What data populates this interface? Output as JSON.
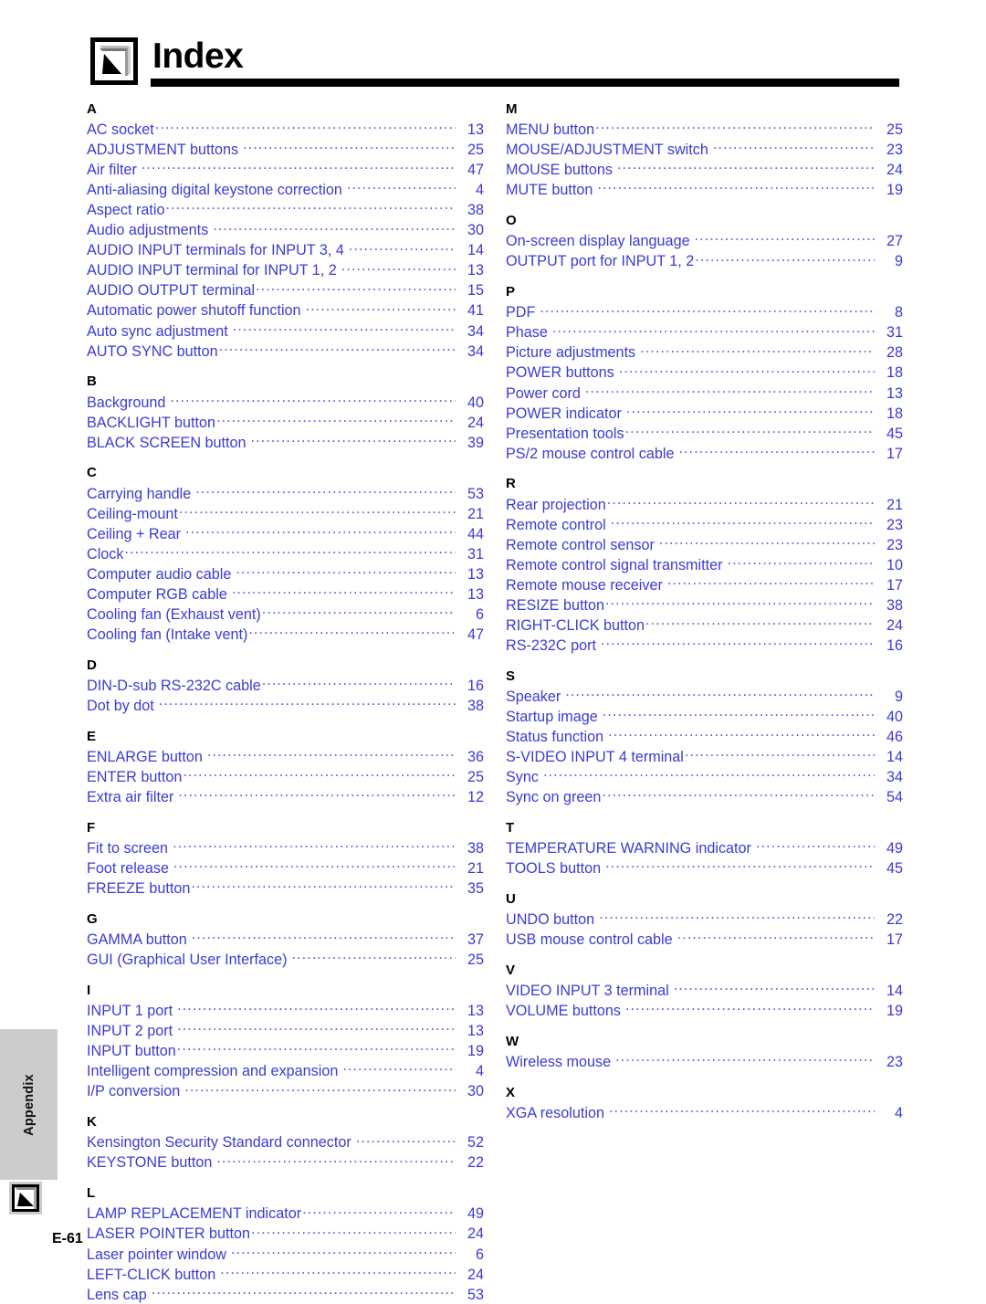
{
  "header": {
    "title": "Index",
    "icon": "book-pages-cursor-icon"
  },
  "side_tab": {
    "label": "Appendix",
    "icon": "book-page-cursor-icon"
  },
  "footer": {
    "page_label": "E-61"
  },
  "colors": {
    "entry_text": "#3b3bd4",
    "leader": "#5a5ada",
    "heading": "#000000",
    "tab_background": "#cccccc"
  },
  "columns": [
    {
      "sections": [
        {
          "letter": "A",
          "entries": [
            {
              "label": "AC socket",
              "page": "13",
              "gap": false
            },
            {
              "label": "ADJUSTMENT buttons",
              "page": "25",
              "gap": true
            },
            {
              "label": "Air filter",
              "page": "47",
              "gap": true
            },
            {
              "label": "Anti-aliasing digital keystone correction",
              "page": "4",
              "gap": true
            },
            {
              "label": "Aspect ratio",
              "page": "38",
              "gap": false
            },
            {
              "label": "Audio adjustments",
              "page": "30",
              "gap": true
            },
            {
              "label": "AUDIO INPUT terminals for INPUT 3, 4",
              "page": "14",
              "gap": true
            },
            {
              "label": "AUDIO INPUT terminal for INPUT 1, 2",
              "page": "13",
              "gap": true
            },
            {
              "label": "AUDIO OUTPUT terminal",
              "page": "15",
              "gap": false
            },
            {
              "label": "Automatic power shutoff function",
              "page": "41",
              "gap": true
            },
            {
              "label": "Auto sync adjustment",
              "page": "34",
              "gap": true
            },
            {
              "label": "AUTO SYNC button",
              "page": "34",
              "gap": false
            }
          ]
        },
        {
          "letter": "B",
          "entries": [
            {
              "label": "Background",
              "page": "40",
              "gap": true
            },
            {
              "label": "BACKLIGHT button",
              "page": "24",
              "gap": false
            },
            {
              "label": "BLACK SCREEN button",
              "page": "39",
              "gap": true
            }
          ]
        },
        {
          "letter": "C",
          "entries": [
            {
              "label": "Carrying handle",
              "page": "53",
              "gap": true
            },
            {
              "label": "Ceiling-mount",
              "page": "21",
              "gap": false
            },
            {
              "label": "Ceiling + Rear",
              "page": "44",
              "gap": true
            },
            {
              "label": "Clock",
              "page": "31",
              "gap": false
            },
            {
              "label": "Computer audio cable",
              "page": "13",
              "gap": true
            },
            {
              "label": "Computer RGB cable",
              "page": "13",
              "gap": true
            },
            {
              "label": "Cooling fan (Exhaust vent)",
              "page": "6",
              "gap": false
            },
            {
              "label": "Cooling fan (Intake vent)",
              "page": "47",
              "gap": false
            }
          ]
        },
        {
          "letter": "D",
          "entries": [
            {
              "label": "DIN-D-sub RS-232C cable",
              "page": "16",
              "gap": false
            },
            {
              "label": "Dot by dot",
              "page": "38",
              "gap": true
            }
          ]
        },
        {
          "letter": "E",
          "entries": [
            {
              "label": "ENLARGE button",
              "page": "36",
              "gap": true
            },
            {
              "label": "ENTER button",
              "page": "25",
              "gap": false
            },
            {
              "label": "Extra air filter",
              "page": "12",
              "gap": true
            }
          ]
        },
        {
          "letter": "F",
          "entries": [
            {
              "label": "Fit to screen",
              "page": "38",
              "gap": true
            },
            {
              "label": "Foot release",
              "page": "21",
              "gap": true
            },
            {
              "label": "FREEZE button",
              "page": "35",
              "gap": false
            }
          ]
        },
        {
          "letter": "G",
          "entries": [
            {
              "label": "GAMMA button",
              "page": "37",
              "gap": true
            },
            {
              "label": "GUI (Graphical User Interface)",
              "page": "25",
              "gap": true
            }
          ]
        },
        {
          "letter": "I",
          "entries": [
            {
              "label": "INPUT 1 port",
              "page": "13",
              "gap": true
            },
            {
              "label": "INPUT 2 port",
              "page": "13",
              "gap": true
            },
            {
              "label": "INPUT button",
              "page": "19",
              "gap": false
            },
            {
              "label": "Intelligent compression and expansion",
              "page": "4",
              "gap": true
            },
            {
              "label": "I/P conversion",
              "page": "30",
              "gap": true
            }
          ]
        },
        {
          "letter": "K",
          "entries": [
            {
              "label": "Kensington Security Standard connector",
              "page": "52",
              "gap": true
            },
            {
              "label": "KEYSTONE button",
              "page": "22",
              "gap": true
            }
          ]
        },
        {
          "letter": "L",
          "entries": [
            {
              "label": "LAMP REPLACEMENT indicator",
              "page": "49",
              "gap": false
            },
            {
              "label": "LASER POINTER button",
              "page": "24",
              "gap": false
            },
            {
              "label": "Laser pointer window",
              "page": "6",
              "gap": true
            },
            {
              "label": "LEFT-CLICK button",
              "page": "24",
              "gap": true
            },
            {
              "label": "Lens cap",
              "page": "53",
              "gap": true
            }
          ]
        }
      ]
    },
    {
      "sections": [
        {
          "letter": "M",
          "entries": [
            {
              "label": "MENU button",
              "page": "25",
              "gap": false
            },
            {
              "label": "MOUSE/ADJUSTMENT switch",
              "page": "23",
              "gap": true
            },
            {
              "label": "MOUSE buttons",
              "page": "24",
              "gap": true
            },
            {
              "label": "MUTE button",
              "page": "19",
              "gap": true
            }
          ]
        },
        {
          "letter": "O",
          "entries": [
            {
              "label": "On-screen display language",
              "page": "27",
              "gap": true
            },
            {
              "label": "OUTPUT port for INPUT 1, 2",
              "page": "9",
              "gap": false
            }
          ]
        },
        {
          "letter": "P",
          "entries": [
            {
              "label": "PDF",
              "page": "8",
              "gap": true
            },
            {
              "label": "Phase",
              "page": "31",
              "gap": true
            },
            {
              "label": "Picture adjustments",
              "page": "28",
              "gap": true
            },
            {
              "label": "POWER buttons",
              "page": "18",
              "gap": true
            },
            {
              "label": "Power cord",
              "page": "13",
              "gap": true
            },
            {
              "label": "POWER indicator",
              "page": "18",
              "gap": true
            },
            {
              "label": "Presentation tools",
              "page": "45",
              "gap": false
            },
            {
              "label": "PS/2 mouse control cable",
              "page": "17",
              "gap": true
            }
          ]
        },
        {
          "letter": "R",
          "entries": [
            {
              "label": "Rear projection",
              "page": "21",
              "gap": false
            },
            {
              "label": "Remote control",
              "page": "23",
              "gap": true
            },
            {
              "label": "Remote control sensor",
              "page": "23",
              "gap": true
            },
            {
              "label": "Remote control signal transmitter",
              "page": "10",
              "gap": true
            },
            {
              "label": "Remote mouse receiver",
              "page": "17",
              "gap": true
            },
            {
              "label": "RESIZE button",
              "page": "38",
              "gap": false
            },
            {
              "label": "RIGHT-CLICK button",
              "page": "24",
              "gap": false
            },
            {
              "label": "RS-232C port",
              "page": "16",
              "gap": true
            }
          ]
        },
        {
          "letter": "S",
          "entries": [
            {
              "label": "Speaker",
              "page": "9",
              "gap": true
            },
            {
              "label": "Startup image",
              "page": "40",
              "gap": true
            },
            {
              "label": "Status function",
              "page": "46",
              "gap": true
            },
            {
              "label": "S-VIDEO INPUT 4 terminal",
              "page": "14",
              "gap": false
            },
            {
              "label": "Sync",
              "page": "34",
              "gap": true
            },
            {
              "label": "Sync on green",
              "page": "54",
              "gap": false
            }
          ]
        },
        {
          "letter": "T",
          "entries": [
            {
              "label": "TEMPERATURE WARNING indicator",
              "page": "49",
              "gap": true
            },
            {
              "label": "TOOLS button",
              "page": "45",
              "gap": true
            }
          ]
        },
        {
          "letter": "U",
          "entries": [
            {
              "label": "UNDO button",
              "page": "22",
              "gap": true
            },
            {
              "label": "USB mouse control cable",
              "page": "17",
              "gap": true
            }
          ]
        },
        {
          "letter": "V",
          "entries": [
            {
              "label": "VIDEO INPUT 3 terminal",
              "page": "14",
              "gap": true
            },
            {
              "label": "VOLUME buttons",
              "page": "19",
              "gap": true
            }
          ]
        },
        {
          "letter": "W",
          "entries": [
            {
              "label": "Wireless mouse",
              "page": "23",
              "gap": true
            }
          ]
        },
        {
          "letter": "X",
          "entries": [
            {
              "label": "XGA resolution",
              "page": "4",
              "gap": true
            }
          ]
        }
      ]
    }
  ]
}
